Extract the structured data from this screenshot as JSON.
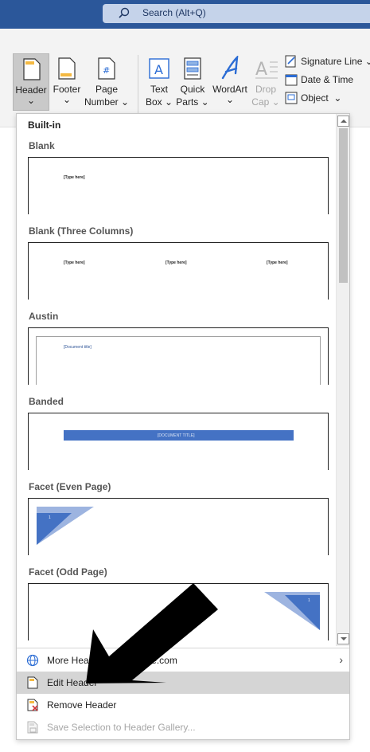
{
  "titlebar": {
    "search_placeholder": "Search (Alt+Q)",
    "accent": "#2b579a"
  },
  "ribbon": {
    "buttons": [
      {
        "label": "Header",
        "chevron": "⌄",
        "icon": "header-page-icon"
      },
      {
        "label": "Footer",
        "chevron": "⌄",
        "icon": "footer-page-icon"
      },
      {
        "label": "Page",
        "label2": "Number",
        "chevron": "⌄",
        "icon": "page-number-icon"
      },
      {
        "label": "Text",
        "label2": "Box",
        "chevron": "⌄",
        "icon": "text-box-icon"
      },
      {
        "label": "Quick",
        "label2": "Parts",
        "chevron": "⌄",
        "icon": "quick-parts-icon"
      },
      {
        "label": "WordArt",
        "chevron": "⌄",
        "icon": "wordart-icon"
      },
      {
        "label": "Drop",
        "label2": "Cap",
        "chevron": "⌄",
        "icon": "drop-cap-icon",
        "disabled": true
      }
    ],
    "small": [
      {
        "label": "Signature Line",
        "chevron": "⌄",
        "icon": "signature-line-icon"
      },
      {
        "label": "Date & Time",
        "icon": "date-time-icon"
      },
      {
        "label": "Object",
        "chevron": "⌄",
        "icon": "object-icon"
      }
    ]
  },
  "menu": {
    "section_title": "Built-in",
    "gallery": [
      {
        "name": "Blank",
        "placeholders": [
          "[Type here]"
        ]
      },
      {
        "name": "Blank (Three Columns)",
        "placeholders": [
          "[Type here]",
          "[Type here]",
          "[Type here]"
        ]
      },
      {
        "name": "Austin",
        "placeholders": [
          "[Document title]"
        ]
      },
      {
        "name": "Banded",
        "placeholders": [
          "[DOCUMENT TITLE]"
        ],
        "band_color": "#4472c4"
      },
      {
        "name": "Facet (Even Page)",
        "placeholders": [
          "1"
        ],
        "facet_color": "#4472c4"
      },
      {
        "name": "Facet (Odd Page)",
        "placeholders": [
          "1"
        ],
        "facet_color": "#4472c4"
      }
    ],
    "items": [
      {
        "label": "More Headers from Office.com",
        "icon": "globe-icon",
        "chevron": "›"
      },
      {
        "label": "Edit Header",
        "icon": "edit-header-icon",
        "highlighted": true
      },
      {
        "label": "Remove Header",
        "icon": "remove-header-icon"
      },
      {
        "label": "Save Selection to Header Gallery...",
        "icon": "save-selection-icon",
        "disabled": true
      }
    ]
  }
}
